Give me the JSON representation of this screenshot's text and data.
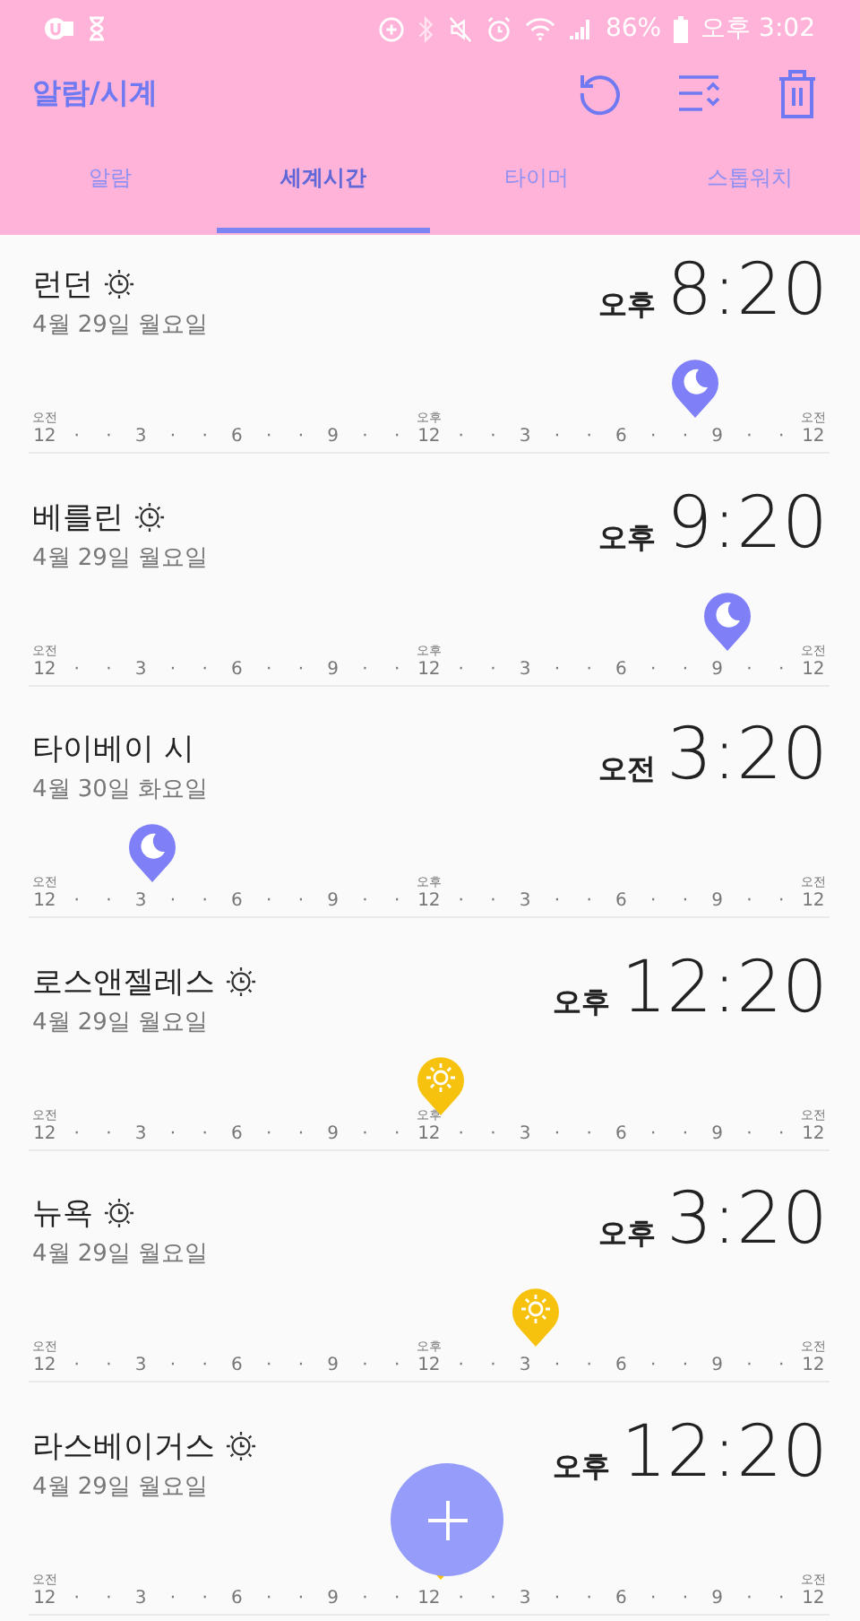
{
  "status_bar": {
    "battery": "86%",
    "time": "오후 3:02"
  },
  "toolbar": {
    "title": "알람/시계"
  },
  "tabs": [
    {
      "label": "알람",
      "selected": false
    },
    {
      "label": "세계시간",
      "selected": true
    },
    {
      "label": "타이머",
      "selected": false
    },
    {
      "label": "스톱워치",
      "selected": false
    }
  ],
  "cities": [
    {
      "name": "런던",
      "dst": true,
      "date": "4월 29일 월요일",
      "period": "오후",
      "time": "8:20",
      "kind": "moon",
      "level": 0.847,
      "scale": [
        {
          "period": "오전",
          "label": "12"
        },
        {
          "label": "·"
        },
        {
          "label": "·"
        },
        {
          "label": "3"
        },
        {
          "label": "·"
        },
        {
          "label": "·"
        },
        {
          "label": "6"
        },
        {
          "label": "·"
        },
        {
          "label": "·"
        },
        {
          "label": "9"
        },
        {
          "label": "·"
        },
        {
          "label": "·"
        },
        {
          "period": "오후",
          "label": "12"
        },
        {
          "label": "·"
        },
        {
          "label": "·"
        },
        {
          "label": "3"
        },
        {
          "label": "·"
        },
        {
          "label": "·"
        },
        {
          "label": "6"
        },
        {
          "label": "·"
        },
        {
          "label": "·"
        },
        {
          "label": "9"
        },
        {
          "label": "·"
        },
        {
          "label": "·"
        },
        {
          "period": "오전",
          "label": "12"
        }
      ]
    },
    {
      "name": "베를린",
      "dst": true,
      "date": "4월 29일 월요일",
      "period": "오후",
      "time": "9:20",
      "kind": "moon",
      "level": 0.889,
      "scale": [
        {
          "period": "오전",
          "label": "12"
        },
        {
          "label": "·"
        },
        {
          "label": "·"
        },
        {
          "label": "3"
        },
        {
          "label": "·"
        },
        {
          "label": "·"
        },
        {
          "label": "6"
        },
        {
          "label": "·"
        },
        {
          "label": "·"
        },
        {
          "label": "9"
        },
        {
          "label": "·"
        },
        {
          "label": "·"
        },
        {
          "period": "오후",
          "label": "12"
        },
        {
          "label": "·"
        },
        {
          "label": "·"
        },
        {
          "label": "3"
        },
        {
          "label": "·"
        },
        {
          "label": "·"
        },
        {
          "label": "6"
        },
        {
          "label": "·"
        },
        {
          "label": "·"
        },
        {
          "label": "9"
        },
        {
          "label": "·"
        },
        {
          "label": "·"
        },
        {
          "period": "오전",
          "label": "12"
        }
      ]
    },
    {
      "name": "타이베이 시",
      "dst": false,
      "date": "4월 30일 화요일",
      "period": "오전",
      "time": "3:20",
      "kind": "moon",
      "level": 0.139,
      "scale": [
        {
          "period": "오전",
          "label": "12"
        },
        {
          "label": "·"
        },
        {
          "label": "·"
        },
        {
          "label": "3"
        },
        {
          "label": "·"
        },
        {
          "label": "·"
        },
        {
          "label": "6"
        },
        {
          "label": "·"
        },
        {
          "label": "·"
        },
        {
          "label": "9"
        },
        {
          "label": "·"
        },
        {
          "label": "·"
        },
        {
          "period": "오후",
          "label": "12"
        },
        {
          "label": "·"
        },
        {
          "label": "·"
        },
        {
          "label": "3"
        },
        {
          "label": "·"
        },
        {
          "label": "·"
        },
        {
          "label": "6"
        },
        {
          "label": "·"
        },
        {
          "label": "·"
        },
        {
          "label": "9"
        },
        {
          "label": "·"
        },
        {
          "label": "·"
        },
        {
          "period": "오전",
          "label": "12"
        }
      ]
    },
    {
      "name": "로스앤젤레스",
      "dst": true,
      "date": "4월 29일 월요일",
      "period": "오후",
      "time": "12:20",
      "kind": "sun",
      "level": 0.514,
      "scale": [
        {
          "period": "오전",
          "label": "12"
        },
        {
          "label": "·"
        },
        {
          "label": "·"
        },
        {
          "label": "3"
        },
        {
          "label": "·"
        },
        {
          "label": "·"
        },
        {
          "label": "6"
        },
        {
          "label": "·"
        },
        {
          "label": "·"
        },
        {
          "label": "9"
        },
        {
          "label": "·"
        },
        {
          "label": "·"
        },
        {
          "period": "오후",
          "label": "12"
        },
        {
          "label": "·"
        },
        {
          "label": "·"
        },
        {
          "label": "3"
        },
        {
          "label": "·"
        },
        {
          "label": "·"
        },
        {
          "label": "6"
        },
        {
          "label": "·"
        },
        {
          "label": "·"
        },
        {
          "label": "9"
        },
        {
          "label": "·"
        },
        {
          "label": "·"
        },
        {
          "period": "오전",
          "label": "12"
        }
      ]
    },
    {
      "name": "뉴욕",
      "dst": true,
      "date": "4월 29일 월요일",
      "period": "오후",
      "time": "3:20",
      "kind": "sun",
      "level": 0.639,
      "scale": [
        {
          "period": "오전",
          "label": "12"
        },
        {
          "label": "·"
        },
        {
          "label": "·"
        },
        {
          "label": "3"
        },
        {
          "label": "·"
        },
        {
          "label": "·"
        },
        {
          "label": "6"
        },
        {
          "label": "·"
        },
        {
          "label": "·"
        },
        {
          "label": "9"
        },
        {
          "label": "·"
        },
        {
          "label": "·"
        },
        {
          "period": "오후",
          "label": "12"
        },
        {
          "label": "·"
        },
        {
          "label": "·"
        },
        {
          "label": "3"
        },
        {
          "label": "·"
        },
        {
          "label": "·"
        },
        {
          "label": "6"
        },
        {
          "label": "·"
        },
        {
          "label": "·"
        },
        {
          "label": "9"
        },
        {
          "label": "·"
        },
        {
          "label": "·"
        },
        {
          "period": "오전",
          "label": "12"
        }
      ]
    },
    {
      "name": "라스베이거스",
      "dst": true,
      "date": "4월 29일 월요일",
      "period": "오후",
      "time": "12:20",
      "kind": "sun",
      "level": 0.514,
      "scale": [
        {
          "period": "오전",
          "label": "12"
        },
        {
          "label": "·"
        },
        {
          "label": "·"
        },
        {
          "label": "3"
        },
        {
          "label": "·"
        },
        {
          "label": "·"
        },
        {
          "label": "6"
        },
        {
          "label": "·"
        },
        {
          "label": "·"
        },
        {
          "label": "9"
        },
        {
          "label": "·"
        },
        {
          "label": "·"
        },
        {
          "label": "12"
        },
        {
          "label": "·"
        },
        {
          "label": "·"
        },
        {
          "label": "3"
        },
        {
          "label": "·"
        },
        {
          "label": "·"
        },
        {
          "label": "6"
        },
        {
          "label": "·"
        },
        {
          "label": "·"
        },
        {
          "label": "9"
        },
        {
          "label": "·"
        },
        {
          "label": "·"
        },
        {
          "period": "오전",
          "label": "12"
        }
      ]
    }
  ]
}
